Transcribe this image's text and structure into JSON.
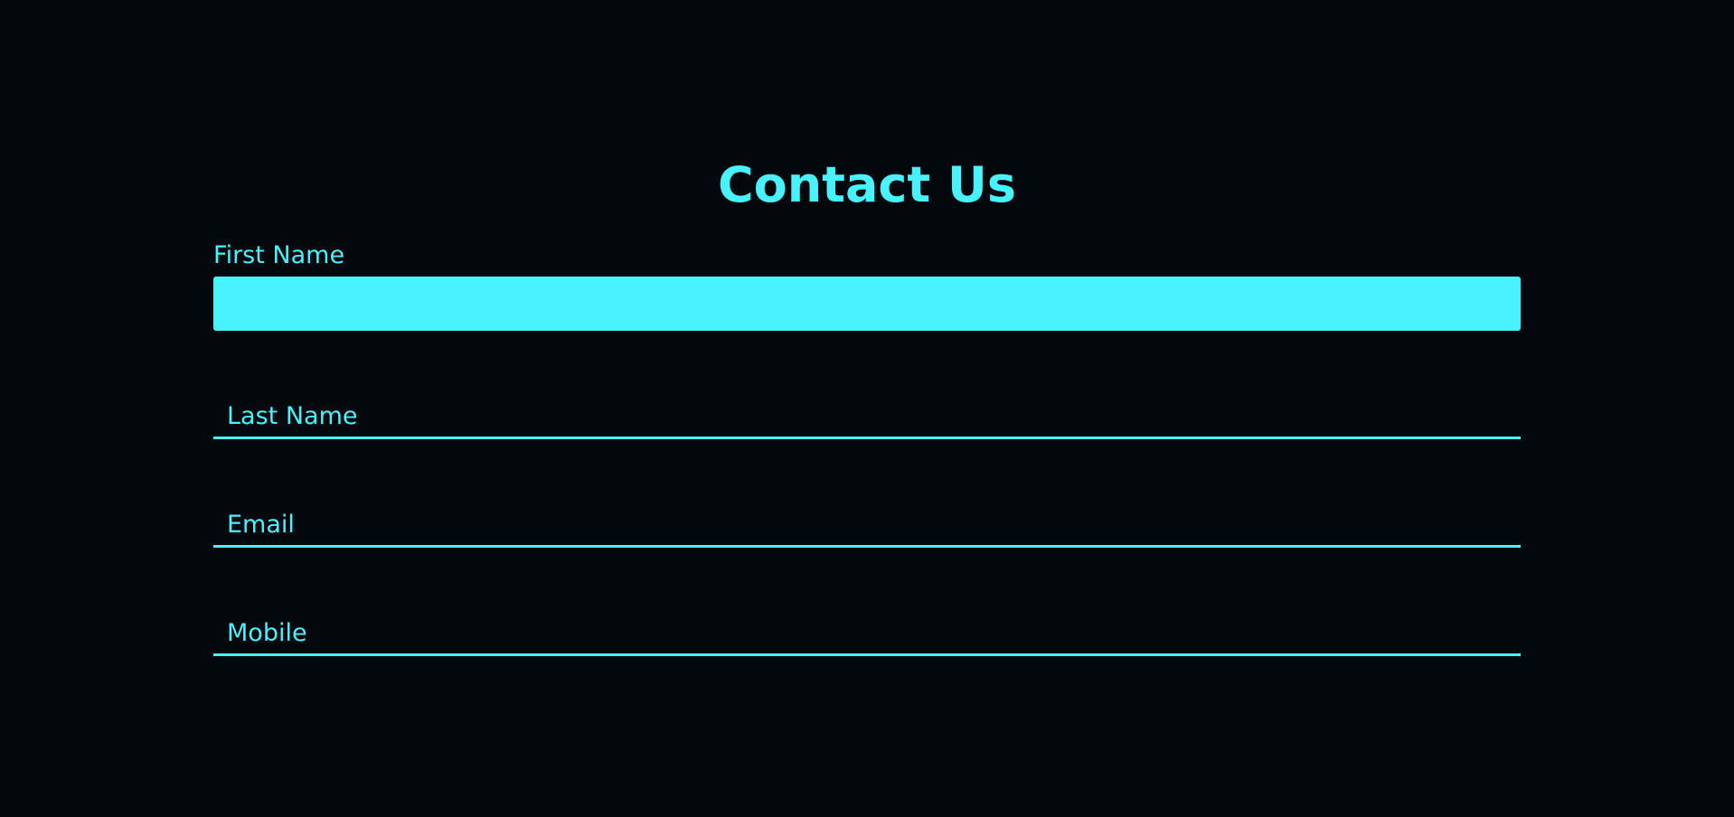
{
  "form": {
    "title": "Contact Us",
    "first_name": {
      "label": "First Name",
      "value": ""
    },
    "last_name": {
      "placeholder": "Last Name",
      "value": ""
    },
    "email": {
      "placeholder": "Email",
      "value": ""
    },
    "mobile": {
      "placeholder": "Mobile",
      "value": ""
    }
  },
  "colors": {
    "background": "#03080c",
    "accent": "#48f3ff"
  }
}
